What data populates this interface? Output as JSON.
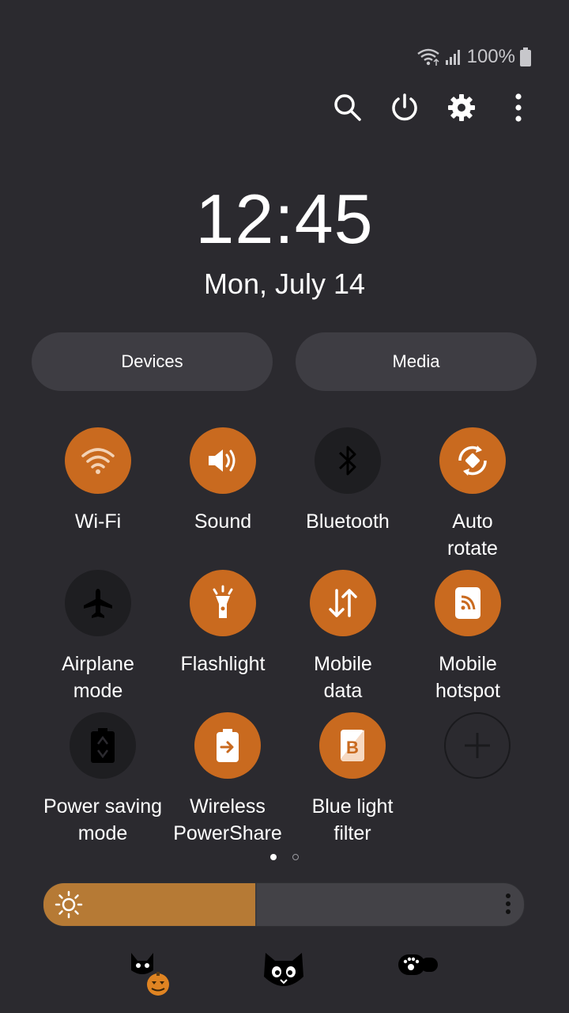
{
  "status": {
    "battery": "100%"
  },
  "actions": [
    {
      "name": "search-icon",
      "label": "Search"
    },
    {
      "name": "power-icon",
      "label": "Power"
    },
    {
      "name": "settings-icon",
      "label": "Settings"
    },
    {
      "name": "more-options-icon",
      "label": "More options"
    }
  ],
  "clock": {
    "time": "12:45",
    "date": "Mon, July 14"
  },
  "pills": {
    "devices": "Devices",
    "media": "Media"
  },
  "tiles": [
    {
      "label": "Wi-Fi",
      "state": "on",
      "icon": "wifi-icon"
    },
    {
      "label": "Sound",
      "state": "on",
      "icon": "volume-icon"
    },
    {
      "label": "Bluetooth",
      "state": "off",
      "icon": "bluetooth-icon"
    },
    {
      "label": "Auto\nrotate",
      "state": "on",
      "icon": "auto-rotate-icon"
    },
    {
      "label": "Airplane\nmode",
      "state": "off",
      "icon": "airplane-icon"
    },
    {
      "label": "Flashlight",
      "state": "on",
      "icon": "flashlight-icon"
    },
    {
      "label": "Mobile\ndata",
      "state": "on",
      "icon": "mobile-data-icon"
    },
    {
      "label": "Mobile\nhotspot",
      "state": "on",
      "icon": "hotspot-icon"
    },
    {
      "label": "Power saving\nmode",
      "state": "off",
      "icon": "power-saving-icon"
    },
    {
      "label": "Wireless\nPowerShare",
      "state": "on",
      "icon": "wireless-powershare-icon"
    },
    {
      "label": "Blue light\nfilter",
      "state": "on",
      "icon": "blue-light-filter-icon"
    },
    {
      "label": "",
      "state": "add",
      "icon": "add-icon"
    }
  ],
  "pager": {
    "pages": 2,
    "current": 1
  },
  "brightness": {
    "level": 0.44
  },
  "colors": {
    "accent": "#c96a1f",
    "background": "#2b2a2f",
    "pill": "#3e3d43",
    "brightness_fill": "#b67a35"
  },
  "notifications": [
    "cat-pumpkin-icon",
    "cat-face-icon",
    "paw-badge-icon"
  ]
}
